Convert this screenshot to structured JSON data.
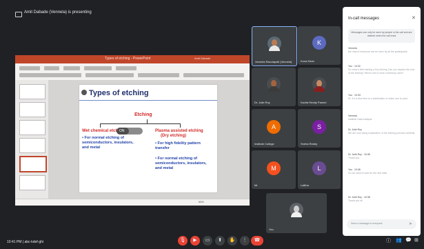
{
  "topbar": {
    "presenting_text": "Amit Dabade (Vennela) is presenting"
  },
  "powerpoint": {
    "window_title": "Types of etching - PowerPoint",
    "user": "Amit Dabade",
    "zoom": "68%",
    "slide": {
      "title": "Types of etching",
      "root": "Etching",
      "left_branch": {
        "title": "Wet chemical etching",
        "bullets": [
          "• For normal etching of semiconductors, insulators, and metal"
        ]
      },
      "right_branch": {
        "title": "Plasma assisted etching",
        "subtitle": "(Dry etching)",
        "bullets": [
          "• For high fidelity pattern transfer",
          "• For normal etching of semiconductors, insulators, and metal"
        ]
      },
      "toggle_label": "ON"
    }
  },
  "participants": [
    {
      "name": "Vennela Ravulapalli (Vennela)",
      "type": "photo",
      "skin": "#b97b52",
      "shirt": "#e8e8e8",
      "bg": "#5b6a74"
    },
    {
      "name": "Kona Kiran",
      "type": "letter",
      "letter": "K",
      "color": "#5c6bc0"
    },
    {
      "name": "Dr. Julie Roy",
      "type": "photo",
      "skin": "#a5643e",
      "shirt": "#3b3b3b",
      "bg": "#3c4043"
    },
    {
      "name": "Kavita Reddy Pammi",
      "type": "photo",
      "skin": "#c68a64",
      "shirt": "#8a1e1e",
      "bg": "#3c4043"
    },
    {
      "name": "Institute College",
      "type": "letter",
      "letter": "A",
      "color": "#ef6c00"
    },
    {
      "name": "Sneha Reddy",
      "type": "letter",
      "letter": "S",
      "color": "#7b1fa2"
    },
    {
      "name": "Mr",
      "type": "letter",
      "letter": "M",
      "color": "#f4511e"
    },
    {
      "name": "Lalitha",
      "type": "letter",
      "letter": "L",
      "color": "#6a4c93"
    },
    {
      "name": "You",
      "type": "photo",
      "skin": "#d0d0d0",
      "shirt": "#f0f0f0",
      "bg": "#5f6368"
    }
  ],
  "chat": {
    "title": "In-call messages",
    "notice": "Messages can only be seen by people in the call and are deleted when the call ends",
    "messages": [
      {
        "who": "Vennela",
        "body": "the chat of everyone can be seen by all the participants"
      },
      {
        "who": "You · 10:32",
        "body": "Do what a Wet etching a Dry etching Can you explain the cost of the etching? Which one is more commonly used?"
      },
      {
        "who": "You · 10:33",
        "body": "Dr. If it is fine then to a clarification of which one is used"
      },
      {
        "who": "Vennela",
        "body": "Institute Data Analysis"
      },
      {
        "who": "Dr. Julie Roy",
        "body": "We are now doing explanation of the etching process carefully"
      },
      {
        "who": "Dr. Julie Roy · 10:35",
        "body": "Thank you"
      },
      {
        "who": "You · 10:36",
        "body": "Do we need to wait for the next slide"
      },
      {
        "who": "Dr. Julie Roy · 10:38",
        "body": "Thank you all"
      }
    ],
    "input_placeholder": "Send a message to everyone"
  },
  "bottombar": {
    "time": "10:41 PM",
    "meeting_code": "abc-kdef-ghi"
  }
}
